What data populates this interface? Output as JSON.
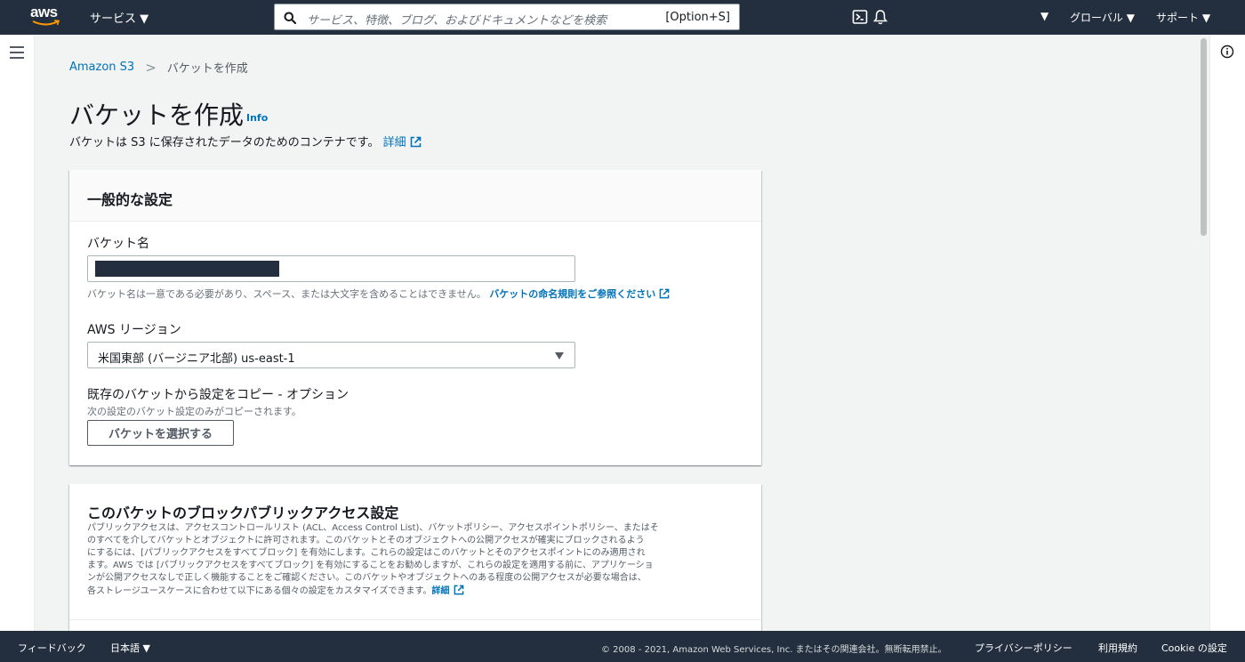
{
  "topnav": {
    "logo_text": "aws",
    "services_label": "サービス ▼",
    "search_placeholder": "サービス、特徴、ブログ、およびドキュメントなどを検索",
    "search_shortcut": "[Option+S]",
    "region_caret": "▼",
    "region_label": "グローバル ▼",
    "support_label": "サポート ▼"
  },
  "breadcrumb": {
    "root": "Amazon S3",
    "separator": ">",
    "current": "バケットを作成"
  },
  "page": {
    "title": "バケットを作成",
    "info_link": "Info",
    "description": "バケットは S3 に保存されたデータのためのコンテナです。",
    "description_link": "詳細"
  },
  "general": {
    "heading": "一般的な設定",
    "bucket_name_label": "バケット名",
    "bucket_name_hint": "バケット名は一意である必要があり、スペース、または大文字を含めることはできません。",
    "bucket_name_hint_link": "バケットの命名規則をご参照ください",
    "region_label": "AWS リージョン",
    "region_value": "米国東部 (バージニア北部) us-east-1",
    "copy_label": "既存のバケットから設定をコピー - オプション",
    "copy_hint": "次の設定のバケット設定のみがコピーされます。",
    "choose_bucket_button": "バケットを選択する"
  },
  "block_public_access": {
    "heading": "このバケットのブロックパブリックアクセス設定",
    "line1": "パブリックアクセスは、アクセスコントロールリスト (ACL、Access Control List)、バケットポリシー、アクセスポイントポリシー、またはそ",
    "line2": "のすべてを介してバケットとオブジェクトに許可されます。このバケットとそのオブジェクトへの公開アクセスが確実にブロックされるよう",
    "line3": "にするには、[パブリックアクセスをすべてブロック] を有効にします。これらの設定はこのバケットとそのアクセスポイントにのみ適用され",
    "line4": "ます。AWS では [パブリックアクセスをすべてブロック] を有効にすることをお勧めしますが、これらの設定を適用する前に、アプリケーショ",
    "line5": "ンが公開アクセスなしで正しく機能することをご確認ください。このバケットやオブジェクトへのある程度の公開アクセスが必要な場合は、",
    "line6": "各ストレージユースケースに合わせて以下にある個々の設定をカスタマイズできます。",
    "link": "詳細"
  },
  "footer": {
    "feedback": "フィードバック",
    "language": "日本語 ▼",
    "copyright": "© 2008 - 2021, Amazon Web Services, Inc. またはその関連会社。無断転用禁止。",
    "privacy": "プライバシーポリシー",
    "terms": "利用規約",
    "cookie": "Cookie の設定"
  },
  "colors": {
    "nav_bg": "#232f3e",
    "link": "#0073bb",
    "logo_smile": "#ff9900",
    "page_bg": "#f2f3f3"
  },
  "icons": {
    "logo_smile": "smile-arrow-icon",
    "search": "search-icon",
    "cloudshell": "cloudshell-icon",
    "bell": "bell-icon",
    "menu": "hamburger-menu-icon",
    "info": "info-circle-icon",
    "external": "external-link-icon",
    "caret": "caret-down-icon"
  }
}
